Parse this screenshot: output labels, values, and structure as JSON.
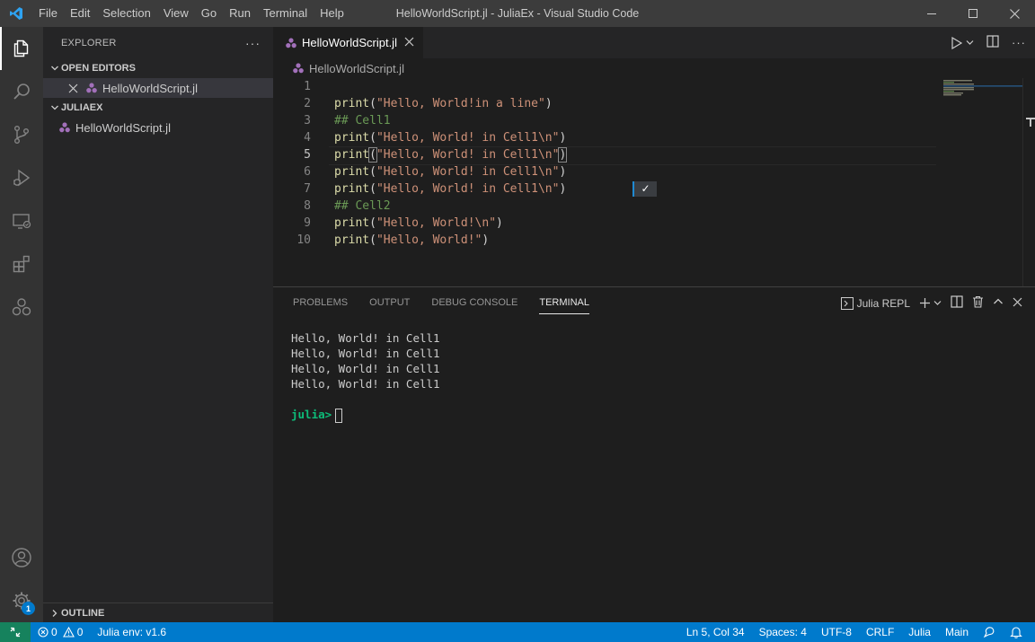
{
  "titlebar": {
    "menus": [
      "File",
      "Edit",
      "Selection",
      "View",
      "Go",
      "Run",
      "Terminal",
      "Help"
    ],
    "window_title": "HelloWorldScript.jl - JuliaEx - Visual Studio Code"
  },
  "activitybar": {
    "items": [
      "explorer-icon",
      "search-icon",
      "source-control-icon",
      "run-debug-icon",
      "remote-explorer-icon",
      "extensions-icon",
      "julia-icon"
    ],
    "bottom": [
      "accounts-icon",
      "manage-gear-icon"
    ],
    "settings_badge": "1"
  },
  "sidebar": {
    "title": "EXPLORER",
    "more_actions": "···",
    "open_editors_label": "OPEN EDITORS",
    "open_editor_file": "HelloWorldScript.jl",
    "folder_label": "JULIAEX",
    "folder_file": "HelloWorldScript.jl",
    "outline_label": "OUTLINE"
  },
  "editor": {
    "tab_label": "HelloWorldScript.jl",
    "breadcrumb": "HelloWorldScript.jl",
    "line_numbers": [
      "1",
      "2",
      "3",
      "4",
      "5",
      "6",
      "7",
      "8",
      "9",
      "10"
    ],
    "current_line": 5,
    "lines": [
      [],
      [
        {
          "t": "fn",
          "v": "print"
        },
        {
          "t": "pun",
          "v": "("
        },
        {
          "t": "str",
          "v": "\"Hello, World!in a line\""
        },
        {
          "t": "pun",
          "v": ")"
        }
      ],
      [
        {
          "t": "cmt",
          "v": "## Cell1"
        }
      ],
      [
        {
          "t": "fn",
          "v": "print"
        },
        {
          "t": "pun",
          "v": "("
        },
        {
          "t": "str",
          "v": "\"Hello, World! in Cell1\\n\""
        },
        {
          "t": "pun",
          "v": ")"
        }
      ],
      [
        {
          "t": "fn",
          "v": "print"
        },
        {
          "t": "pun bracket",
          "v": "("
        },
        {
          "t": "str",
          "v": "\"Hello, World! in Cell1\\n\""
        },
        {
          "t": "pun bracket",
          "v": ")"
        }
      ],
      [
        {
          "t": "fn",
          "v": "print"
        },
        {
          "t": "pun",
          "v": "("
        },
        {
          "t": "str",
          "v": "\"Hello, World! in Cell1\\n\""
        },
        {
          "t": "pun",
          "v": ")"
        }
      ],
      [
        {
          "t": "fn",
          "v": "print"
        },
        {
          "t": "pun",
          "v": "("
        },
        {
          "t": "str",
          "v": "\"Hello, World! in Cell1\\n\""
        },
        {
          "t": "pun",
          "v": ")"
        }
      ],
      [
        {
          "t": "cmt",
          "v": "## Cell2"
        }
      ],
      [
        {
          "t": "fn",
          "v": "print"
        },
        {
          "t": "pun",
          "v": "("
        },
        {
          "t": "str",
          "v": "\"Hello, World!\\n\""
        },
        {
          "t": "pun",
          "v": ")"
        }
      ],
      [
        {
          "t": "fn",
          "v": "print"
        },
        {
          "t": "pun",
          "v": "("
        },
        {
          "t": "str",
          "v": "\"Hello, World!\""
        },
        {
          "t": "pun",
          "v": ")"
        }
      ]
    ],
    "inline_result_line": 7,
    "inline_result": "✓"
  },
  "panel": {
    "tabs": [
      "PROBLEMS",
      "OUTPUT",
      "DEBUG CONSOLE",
      "TERMINAL"
    ],
    "active_tab": "TERMINAL",
    "terminal_name": "Julia REPL",
    "terminal_output": [
      "Hello, World! in Cell1",
      "Hello, World! in Cell1",
      "Hello, World! in Cell1",
      "Hello, World! in Cell1",
      ""
    ],
    "prompt": "julia>"
  },
  "statusbar": {
    "errors": "0",
    "warnings": "0",
    "julia_env": "Julia env: v1.6",
    "cursor_position": "Ln 5, Col 34",
    "indentation": "Spaces: 4",
    "encoding": "UTF-8",
    "eol": "CRLF",
    "language": "Julia",
    "env_mode": "Main"
  },
  "colors": {
    "accent": "#007acc",
    "remote": "#16825d",
    "julia_prompt": "#0dbc79"
  }
}
